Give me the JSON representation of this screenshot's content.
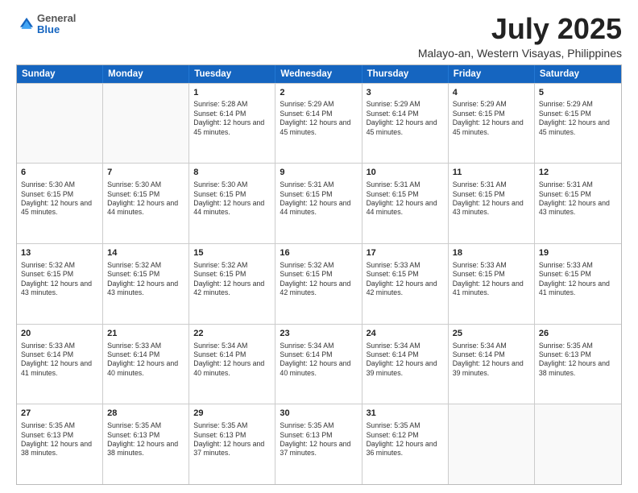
{
  "logo": {
    "general": "General",
    "blue": "Blue"
  },
  "title": "July 2025",
  "subtitle": "Malayo-an, Western Visayas, Philippines",
  "days": [
    "Sunday",
    "Monday",
    "Tuesday",
    "Wednesday",
    "Thursday",
    "Friday",
    "Saturday"
  ],
  "weeks": [
    [
      {
        "day": "",
        "empty": true
      },
      {
        "day": "",
        "empty": true
      },
      {
        "day": "1",
        "sunrise": "Sunrise: 5:28 AM",
        "sunset": "Sunset: 6:14 PM",
        "daylight": "Daylight: 12 hours and 45 minutes."
      },
      {
        "day": "2",
        "sunrise": "Sunrise: 5:29 AM",
        "sunset": "Sunset: 6:14 PM",
        "daylight": "Daylight: 12 hours and 45 minutes."
      },
      {
        "day": "3",
        "sunrise": "Sunrise: 5:29 AM",
        "sunset": "Sunset: 6:14 PM",
        "daylight": "Daylight: 12 hours and 45 minutes."
      },
      {
        "day": "4",
        "sunrise": "Sunrise: 5:29 AM",
        "sunset": "Sunset: 6:15 PM",
        "daylight": "Daylight: 12 hours and 45 minutes."
      },
      {
        "day": "5",
        "sunrise": "Sunrise: 5:29 AM",
        "sunset": "Sunset: 6:15 PM",
        "daylight": "Daylight: 12 hours and 45 minutes."
      }
    ],
    [
      {
        "day": "6",
        "sunrise": "Sunrise: 5:30 AM",
        "sunset": "Sunset: 6:15 PM",
        "daylight": "Daylight: 12 hours and 45 minutes."
      },
      {
        "day": "7",
        "sunrise": "Sunrise: 5:30 AM",
        "sunset": "Sunset: 6:15 PM",
        "daylight": "Daylight: 12 hours and 44 minutes."
      },
      {
        "day": "8",
        "sunrise": "Sunrise: 5:30 AM",
        "sunset": "Sunset: 6:15 PM",
        "daylight": "Daylight: 12 hours and 44 minutes."
      },
      {
        "day": "9",
        "sunrise": "Sunrise: 5:31 AM",
        "sunset": "Sunset: 6:15 PM",
        "daylight": "Daylight: 12 hours and 44 minutes."
      },
      {
        "day": "10",
        "sunrise": "Sunrise: 5:31 AM",
        "sunset": "Sunset: 6:15 PM",
        "daylight": "Daylight: 12 hours and 44 minutes."
      },
      {
        "day": "11",
        "sunrise": "Sunrise: 5:31 AM",
        "sunset": "Sunset: 6:15 PM",
        "daylight": "Daylight: 12 hours and 43 minutes."
      },
      {
        "day": "12",
        "sunrise": "Sunrise: 5:31 AM",
        "sunset": "Sunset: 6:15 PM",
        "daylight": "Daylight: 12 hours and 43 minutes."
      }
    ],
    [
      {
        "day": "13",
        "sunrise": "Sunrise: 5:32 AM",
        "sunset": "Sunset: 6:15 PM",
        "daylight": "Daylight: 12 hours and 43 minutes."
      },
      {
        "day": "14",
        "sunrise": "Sunrise: 5:32 AM",
        "sunset": "Sunset: 6:15 PM",
        "daylight": "Daylight: 12 hours and 43 minutes."
      },
      {
        "day": "15",
        "sunrise": "Sunrise: 5:32 AM",
        "sunset": "Sunset: 6:15 PM",
        "daylight": "Daylight: 12 hours and 42 minutes."
      },
      {
        "day": "16",
        "sunrise": "Sunrise: 5:32 AM",
        "sunset": "Sunset: 6:15 PM",
        "daylight": "Daylight: 12 hours and 42 minutes."
      },
      {
        "day": "17",
        "sunrise": "Sunrise: 5:33 AM",
        "sunset": "Sunset: 6:15 PM",
        "daylight": "Daylight: 12 hours and 42 minutes."
      },
      {
        "day": "18",
        "sunrise": "Sunrise: 5:33 AM",
        "sunset": "Sunset: 6:15 PM",
        "daylight": "Daylight: 12 hours and 41 minutes."
      },
      {
        "day": "19",
        "sunrise": "Sunrise: 5:33 AM",
        "sunset": "Sunset: 6:15 PM",
        "daylight": "Daylight: 12 hours and 41 minutes."
      }
    ],
    [
      {
        "day": "20",
        "sunrise": "Sunrise: 5:33 AM",
        "sunset": "Sunset: 6:14 PM",
        "daylight": "Daylight: 12 hours and 41 minutes."
      },
      {
        "day": "21",
        "sunrise": "Sunrise: 5:33 AM",
        "sunset": "Sunset: 6:14 PM",
        "daylight": "Daylight: 12 hours and 40 minutes."
      },
      {
        "day": "22",
        "sunrise": "Sunrise: 5:34 AM",
        "sunset": "Sunset: 6:14 PM",
        "daylight": "Daylight: 12 hours and 40 minutes."
      },
      {
        "day": "23",
        "sunrise": "Sunrise: 5:34 AM",
        "sunset": "Sunset: 6:14 PM",
        "daylight": "Daylight: 12 hours and 40 minutes."
      },
      {
        "day": "24",
        "sunrise": "Sunrise: 5:34 AM",
        "sunset": "Sunset: 6:14 PM",
        "daylight": "Daylight: 12 hours and 39 minutes."
      },
      {
        "day": "25",
        "sunrise": "Sunrise: 5:34 AM",
        "sunset": "Sunset: 6:14 PM",
        "daylight": "Daylight: 12 hours and 39 minutes."
      },
      {
        "day": "26",
        "sunrise": "Sunrise: 5:35 AM",
        "sunset": "Sunset: 6:13 PM",
        "daylight": "Daylight: 12 hours and 38 minutes."
      }
    ],
    [
      {
        "day": "27",
        "sunrise": "Sunrise: 5:35 AM",
        "sunset": "Sunset: 6:13 PM",
        "daylight": "Daylight: 12 hours and 38 minutes."
      },
      {
        "day": "28",
        "sunrise": "Sunrise: 5:35 AM",
        "sunset": "Sunset: 6:13 PM",
        "daylight": "Daylight: 12 hours and 38 minutes."
      },
      {
        "day": "29",
        "sunrise": "Sunrise: 5:35 AM",
        "sunset": "Sunset: 6:13 PM",
        "daylight": "Daylight: 12 hours and 37 minutes."
      },
      {
        "day": "30",
        "sunrise": "Sunrise: 5:35 AM",
        "sunset": "Sunset: 6:13 PM",
        "daylight": "Daylight: 12 hours and 37 minutes."
      },
      {
        "day": "31",
        "sunrise": "Sunrise: 5:35 AM",
        "sunset": "Sunset: 6:12 PM",
        "daylight": "Daylight: 12 hours and 36 minutes."
      },
      {
        "day": "",
        "empty": true
      },
      {
        "day": "",
        "empty": true
      }
    ]
  ]
}
